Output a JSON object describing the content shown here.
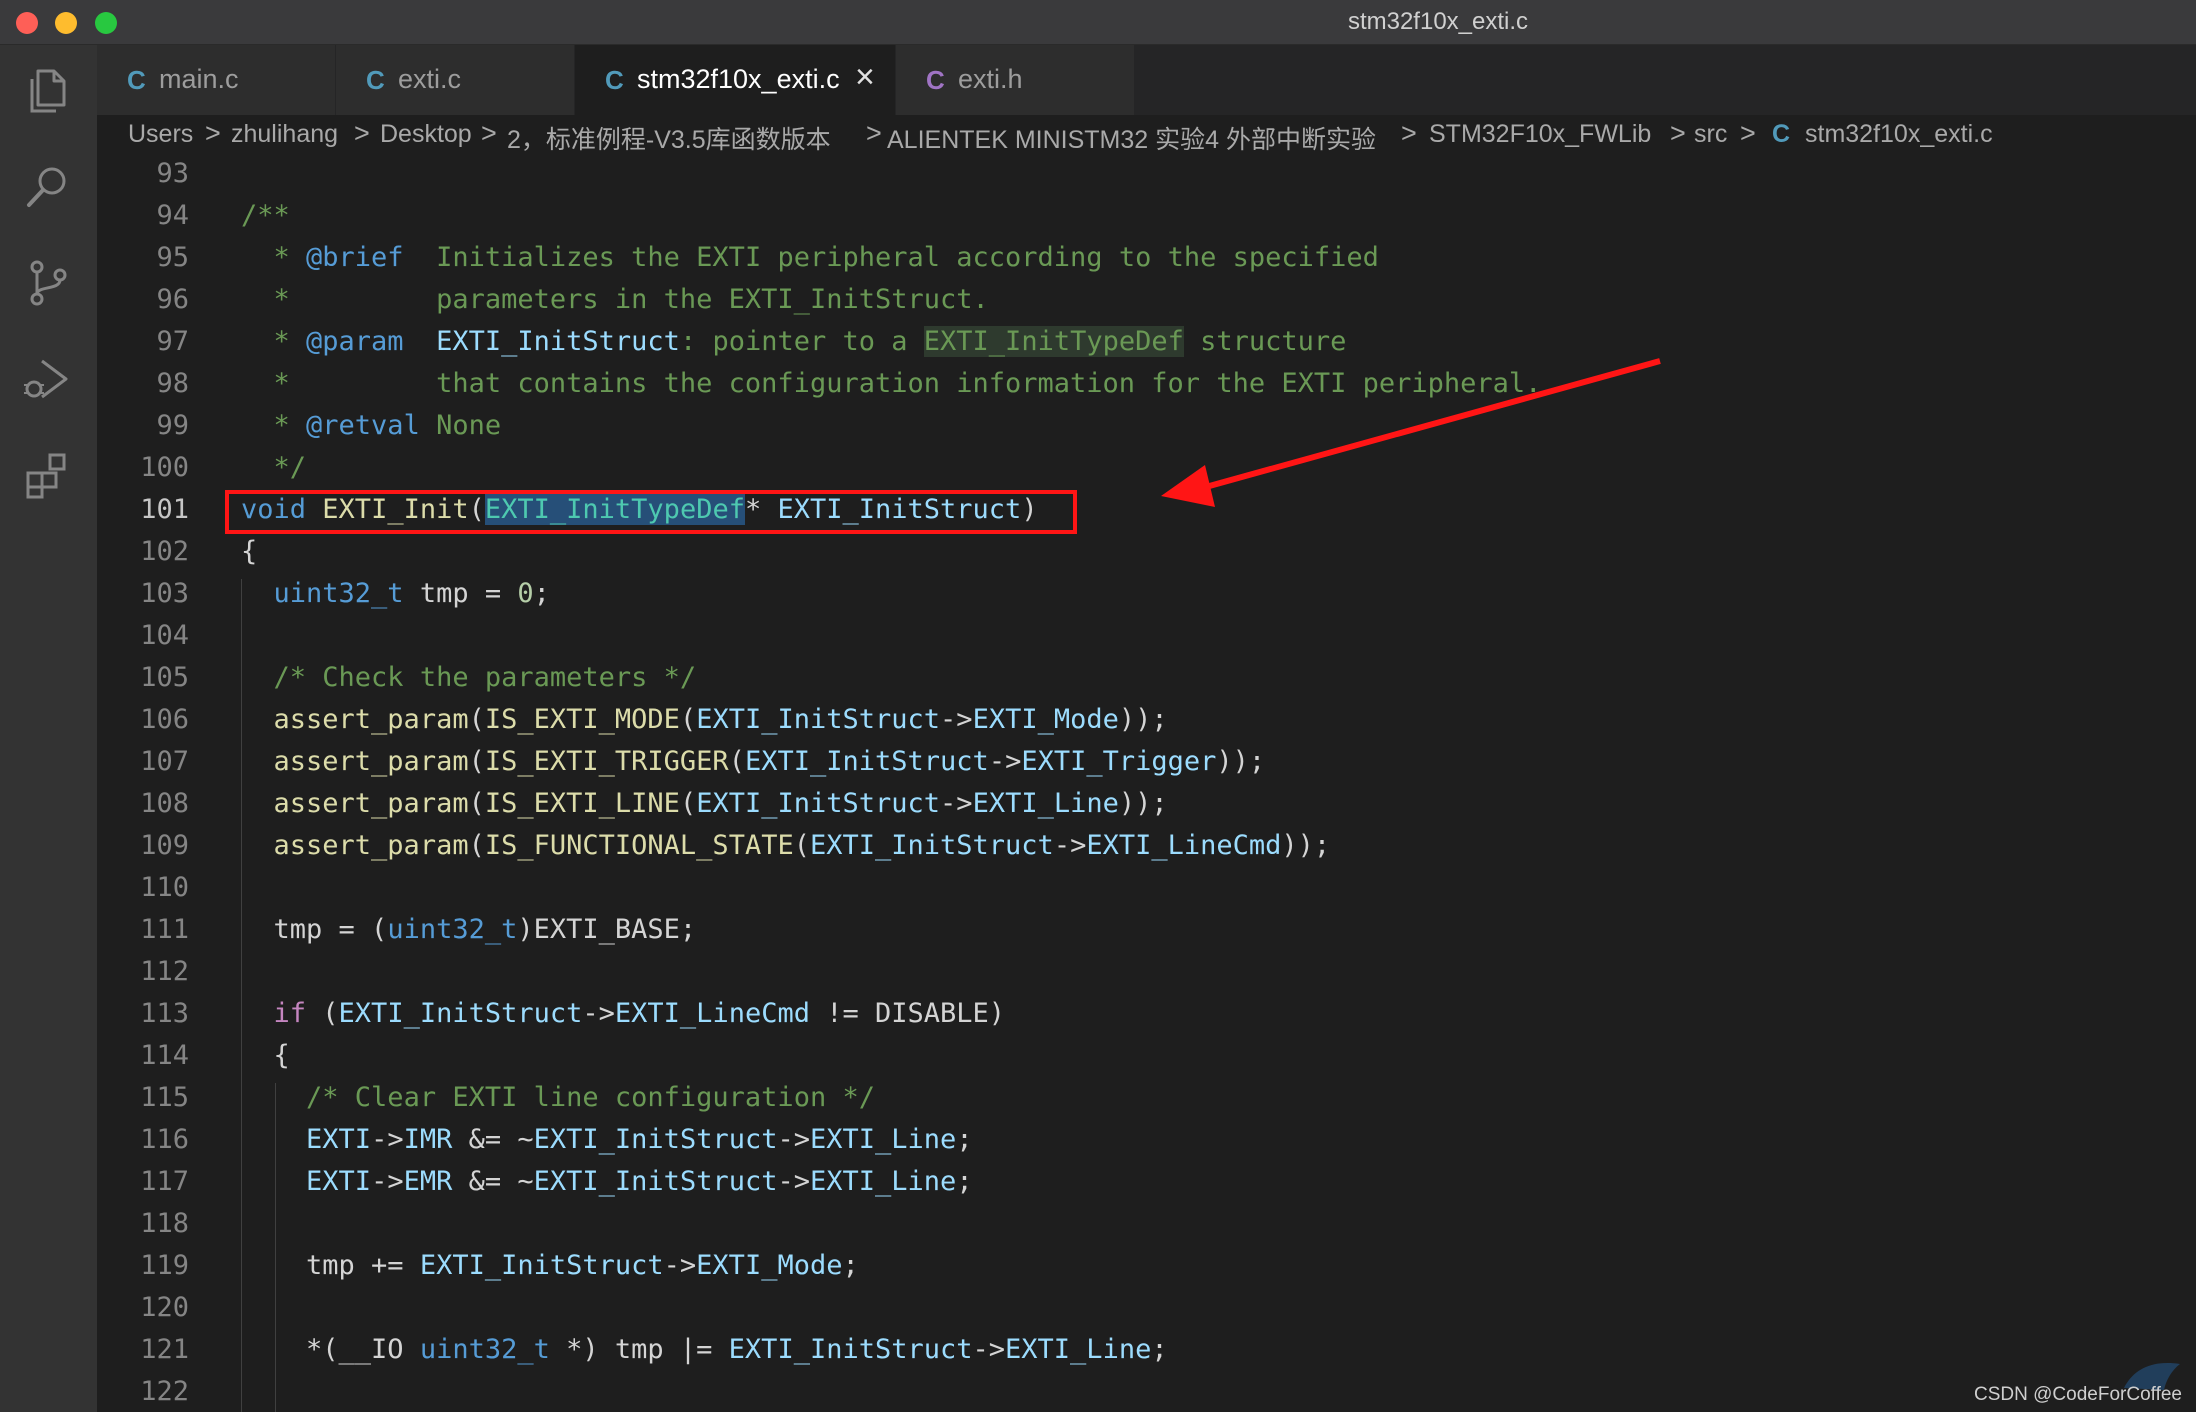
{
  "window": {
    "title": "stm32f10x_exti.c"
  },
  "activity_bar": [
    "files-icon",
    "search-icon",
    "source-control-icon",
    "run-debug-icon",
    "extensions-icon"
  ],
  "tabs": [
    {
      "icon": "C",
      "label": "main.c",
      "active": false
    },
    {
      "icon": "C",
      "label": "exti.c",
      "active": false
    },
    {
      "icon": "C",
      "label": "stm32f10x_exti.c",
      "active": true,
      "close": "×"
    },
    {
      "icon": "C",
      "label": "exti.h",
      "active": false
    }
  ],
  "breadcrumb": {
    "items": [
      "Users",
      "zhulihang",
      "Desktop",
      "2，标准例程-V3.5库函数版本",
      "ALIENTEK MINISTM32 实验4 外部中断实验",
      "STM32F10x_FWLib",
      "src"
    ],
    "file_icon": "C",
    "file": "stm32f10x_exti.c",
    "separator": ">"
  },
  "editor": {
    "line_numbers": [
      "93",
      "94",
      "95",
      "96",
      "97",
      "98",
      "99",
      "100",
      "101",
      "102",
      "103",
      "104",
      "105",
      "106",
      "107",
      "108",
      "109",
      "110",
      "111",
      "112",
      "113",
      "114",
      "115",
      "116",
      "117",
      "118",
      "119",
      "120",
      "121",
      "122"
    ],
    "current_line": "101"
  },
  "watermark": "CSDN @CodeForCoffee",
  "colors": {
    "annotation": "#ff1515",
    "accent": "#519aba"
  }
}
